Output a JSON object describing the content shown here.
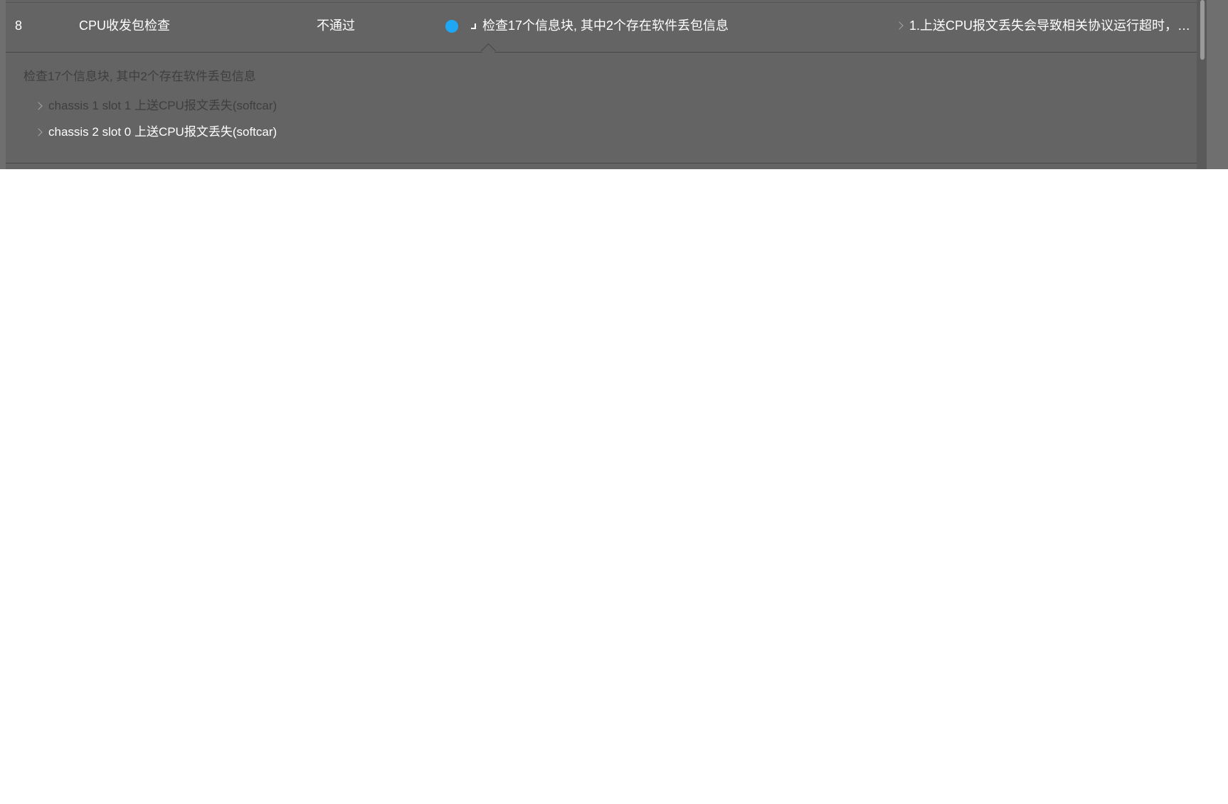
{
  "row": {
    "index": "8",
    "name": "CPU收发包检查",
    "result": "不通过",
    "status_color": "#1da7f5",
    "detail": "检查17个信息块, 其中2个存在软件丢包信息",
    "advice": "1.上送CPU报文丢失会导致相关协议运行超时，占..."
  },
  "expanded": {
    "title": "检查17个信息块, 其中2个存在软件丢包信息",
    "items": [
      {
        "label": "chassis 1 slot 1 上送CPU报文丢失(softcar)"
      },
      {
        "label": "chassis 2 slot 0 上送CPU报文丢失(softcar)"
      }
    ]
  }
}
